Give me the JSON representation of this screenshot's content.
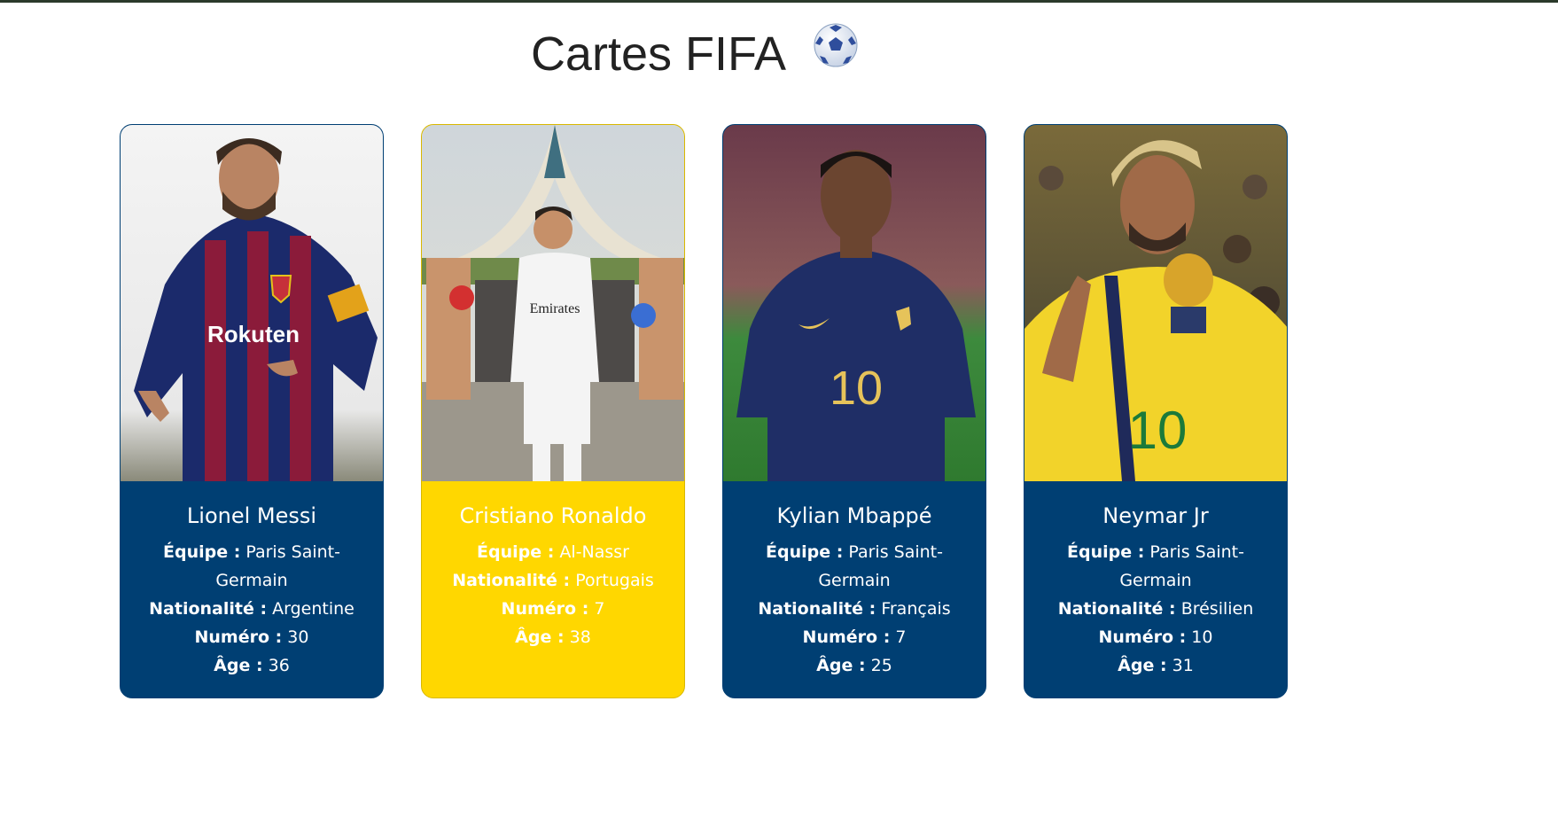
{
  "page": {
    "title": "Cartes FIFA"
  },
  "icons": {
    "title_icon": "soccer-ball-icon"
  },
  "colors": {
    "card_blue": "#003f73",
    "card_yellow": "#ffd700"
  },
  "cards": [
    {
      "name": "Lionel Messi",
      "team_label": "Équipe :",
      "team": "Paris Saint-Germain",
      "nationality_label": "Nationalité :",
      "nationality": "Argentine",
      "number_label": "Numéro :",
      "number": "30",
      "age_label": "Âge :",
      "age": "36"
    },
    {
      "name": "Cristiano Ronaldo",
      "team_label": "Équipe :",
      "team": "Al-Nassr",
      "nationality_label": "Nationalité :",
      "nationality": "Portugais",
      "number_label": "Numéro :",
      "number": "7",
      "age_label": "Âge :",
      "age": "38"
    },
    {
      "name": "Kylian Mbappé",
      "team_label": "Équipe :",
      "team": "Paris Saint-Germain",
      "nationality_label": "Nationalité :",
      "nationality": "Français",
      "number_label": "Numéro :",
      "number": "7",
      "age_label": "Âge :",
      "age": "25"
    },
    {
      "name": "Neymar Jr",
      "team_label": "Équipe :",
      "team": "Paris Saint-Germain",
      "nationality_label": "Nationalité :",
      "nationality": "Brésilien",
      "number_label": "Numéro :",
      "number": "10",
      "age_label": "Âge :",
      "age": "31"
    }
  ],
  "photo_text": {
    "messi_sponsor": "Rokuten",
    "ronaldo_sponsor": "Emirates",
    "mbappe_number": "10",
    "neymar_number": "10"
  }
}
